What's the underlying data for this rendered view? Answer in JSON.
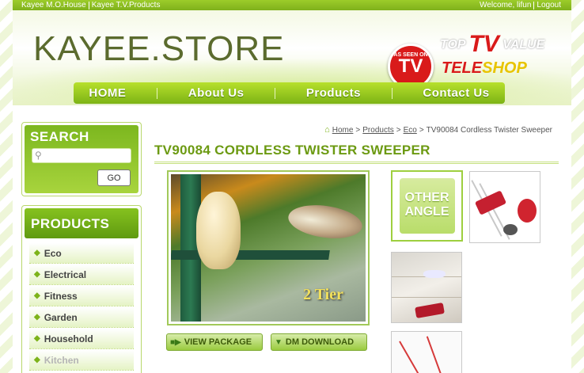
{
  "topbar": {
    "link1": "Kayee M.O.House",
    "link2": "Kayee T.V.Products",
    "welcome": "Welcome, lifun",
    "logout": "Logout"
  },
  "header": {
    "logo": "KAYEE.STORE",
    "badge_small": "AS SEEN ON",
    "badge_big": "TV",
    "topvalue_a": "TOP",
    "topvalue_tv": "TV",
    "topvalue_b": "VALUE",
    "tele": "TELE",
    "shop": "SHOP"
  },
  "nav": {
    "items": [
      "HOME",
      "About Us",
      "Products",
      "Contact Us"
    ]
  },
  "search": {
    "title": "SEARCH",
    "placeholder": "",
    "button": "GO"
  },
  "products": {
    "title": "PRODUCTS",
    "categories": [
      "Eco",
      "Electrical",
      "Fitness",
      "Garden",
      "Household",
      "Kitchen"
    ]
  },
  "breadcrumb": {
    "home": "Home",
    "c1": "Products",
    "c2": "Eco",
    "c3": "TV90084 Cordless Twister Sweeper",
    "sep": ">"
  },
  "product": {
    "title": "TV90084 CORDLESS TWISTER SWEEPER",
    "image_caption": "2 Tier",
    "view_package": "VIEW PACKAGE",
    "dm_download": "DM DOWNLOAD",
    "other_angle_1": "OTHER",
    "other_angle_2": "ANGLE"
  },
  "colors": {
    "brand_green": "#7db31a",
    "title_green": "#6c9a12",
    "badge_red": "#d91a1a"
  }
}
